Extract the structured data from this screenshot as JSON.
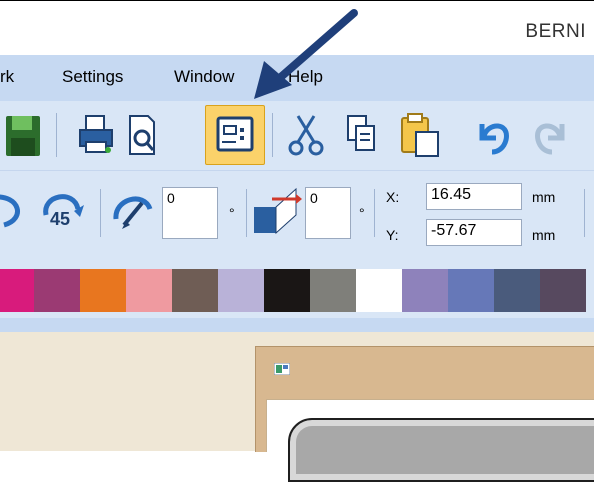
{
  "window": {
    "title": "BERNI"
  },
  "menu": {
    "items": [
      {
        "label": "rk",
        "left": 0
      },
      {
        "label": "Settings",
        "left": 0
      },
      {
        "label": "Window",
        "left": 0
      },
      {
        "label": "Help",
        "left": 0
      }
    ]
  },
  "toolbar": {
    "rotate_value": "0",
    "rotate_unit": "°",
    "skew_value": "0",
    "skew_unit": "°",
    "x_label": "X:",
    "x_value": "16.45",
    "x_unit": "mm",
    "y_label": "Y:",
    "y_value": "-57.67",
    "y_unit": "mm",
    "rotate_45_label": "45"
  },
  "palette": {
    "colors": [
      "#d81b7c",
      "#9b3a73",
      "#e8761f",
      "#ef9aa0",
      "#6f5d55",
      "#b9b2d8",
      "#1a1615",
      "#7f7f7a",
      "#ffffff",
      "#8e82bb",
      "#6678b8",
      "#4a5b7c",
      "#57495f"
    ]
  },
  "annotation": {
    "arrow_color": "#1f3f7a"
  }
}
